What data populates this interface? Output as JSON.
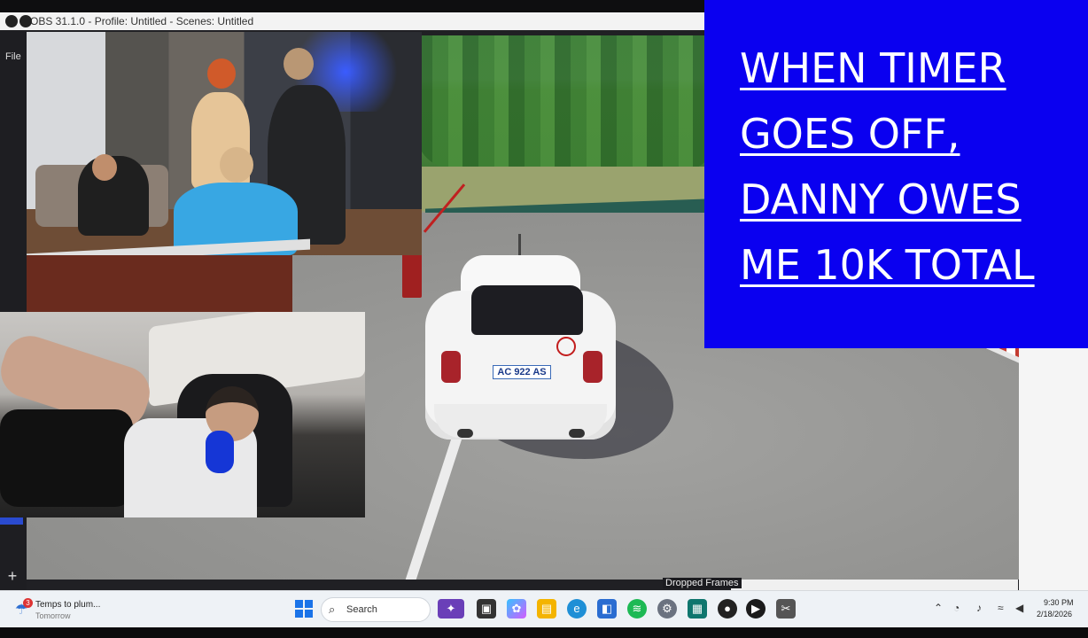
{
  "window": {
    "title": "OBS 31.1.0 - Profile: Untitled - Scenes: Untitled",
    "menu_file": "File",
    "add_button": "+",
    "dropped_frames_label": "Dropped Frames"
  },
  "banner": {
    "lines": [
      "WHEN TIMER",
      "GOES OFF,",
      "DANNY OWES",
      "ME 10K TOTAL"
    ],
    "background": "#0a00f0",
    "text_color": "#ffffff"
  },
  "game": {
    "plate": "AC 922 AS"
  },
  "taskbar": {
    "weather_title": "Temps to plum...",
    "weather_sub": "Tomorrow",
    "weather_badge": "3",
    "search_placeholder": "Search",
    "time": "9:30 PM",
    "date": "2/18/2026",
    "apps": [
      "widgets-icon",
      "task-view-icon",
      "copilot-icon",
      "file-explorer-icon",
      "edge-icon",
      "store-icon",
      "spotify-icon",
      "settings-icon",
      "photos-icon",
      "game-icon",
      "obs-icon",
      "snip-icon"
    ]
  }
}
